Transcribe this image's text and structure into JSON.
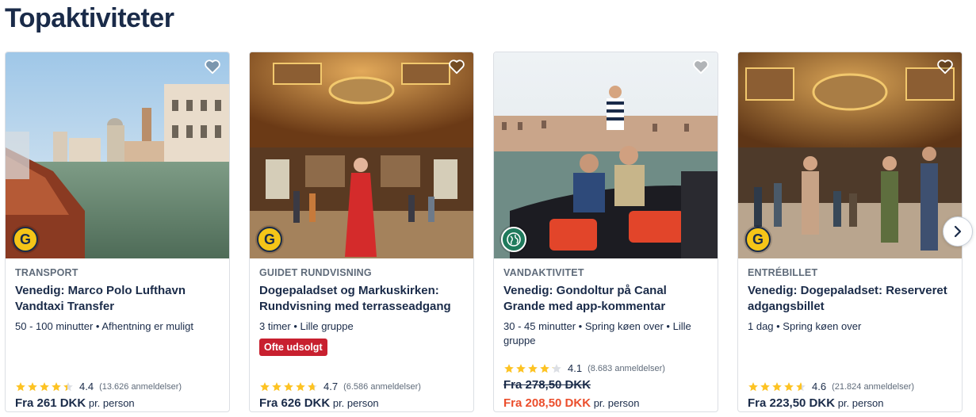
{
  "section": {
    "title": "Topaktiviteter"
  },
  "cards": [
    {
      "category": "TRANSPORT",
      "title": "Venedig: Marco Polo Lufthavn Vandtaxi Transfer",
      "meta": "50 - 100 minutter • Afhentning er muligt",
      "tag": "",
      "rating": 4.4,
      "rating_text": "4.4",
      "reviews": "(13.626 anmeldelser)",
      "old_price": "",
      "price_prefix": "Fra",
      "price": "261 DKK",
      "price_suffix": "pr. person",
      "badge": "G",
      "image": "water-taxi-grand-canal"
    },
    {
      "category": "GUIDET RUNDVISNING",
      "title": "Dogepaladset og Markuskirken: Rundvisning med terrasseadgang",
      "meta": "3 timer • Lille gruppe",
      "tag": "Ofte udsolgt",
      "rating": 4.7,
      "rating_text": "4.7",
      "reviews": "(6.586 anmeldelser)",
      "old_price": "",
      "price_prefix": "Fra",
      "price": "626 DKK",
      "price_suffix": "pr. person",
      "badge": "G",
      "image": "doges-palace-red-dress"
    },
    {
      "category": "VANDAKTIVITET",
      "title": "Venedig: Gondoltur på Canal Grande med app-kommentar",
      "meta": "30 - 45 minutter • Spring køen over • Lille gruppe",
      "tag": "",
      "rating": 4.1,
      "rating_text": "4.1",
      "reviews": "(8.683 anmeldelser)",
      "old_price": "Fra 278,50 DKK",
      "price_prefix": "Fra",
      "price": "208,50 DKK",
      "price_suffix": "pr. person",
      "badge": "eco",
      "image": "gondola-couple"
    },
    {
      "category": "ENTRÉBILLET",
      "title": "Venedig: Dogepaladset: Reserveret adgangsbillet",
      "meta": "1 dag • Spring køen over",
      "tag": "",
      "rating": 4.6,
      "rating_text": "4.6",
      "reviews": "(21.824 anmeldelser)",
      "old_price": "",
      "price_prefix": "Fra",
      "price": "223,50 DKK",
      "price_suffix": "pr. person",
      "badge": "G",
      "image": "doges-palace-hall-crowd"
    }
  ],
  "icons": {
    "wishlist": "heart-outline-icon",
    "next": "chevron-right-icon",
    "star": "star-icon"
  },
  "colors": {
    "heading": "#1a2b49",
    "star": "#fdc323",
    "sale_price": "#eb4e2c",
    "tag_bg": "#c8202f",
    "badge_yellow": "#f5c518",
    "badge_eco": "#1f7a5c"
  }
}
